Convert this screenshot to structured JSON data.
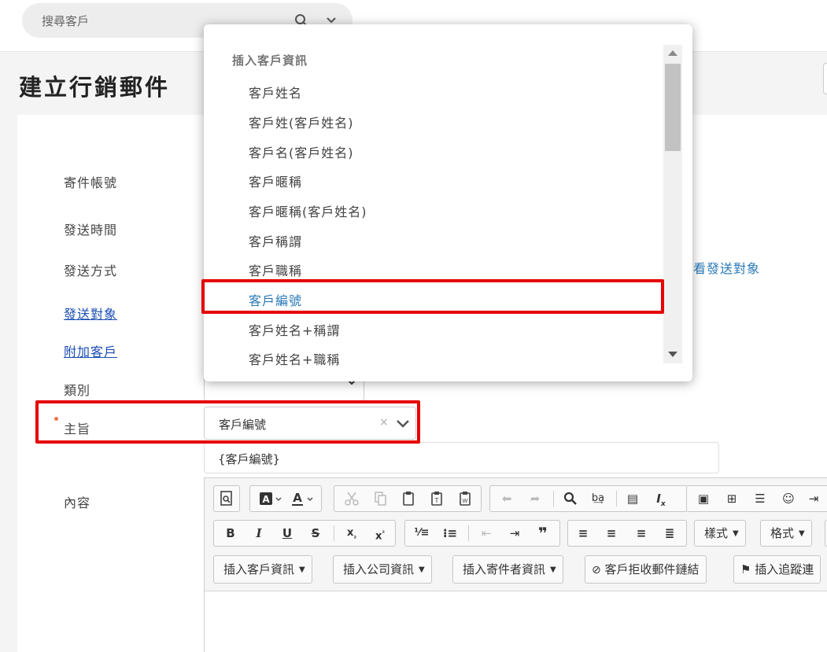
{
  "search": {
    "placeholder": "搜尋客戶"
  },
  "page": {
    "title": "建立行銷郵件"
  },
  "form": {
    "sender_account_label": "寄件帳號",
    "send_time_label": "發送時間",
    "send_method_label": "發送方式",
    "recipients_link": "發送對象",
    "attach_customers_link": "附加客戶",
    "category_label": "類別",
    "subject_label": "主旨",
    "content_label": "內容",
    "view_recipients_link": "看發送對象",
    "subject_value": "客戶編號",
    "subject_clear": "×",
    "subject_preview": "{客戶編號}"
  },
  "dropdown": {
    "heading": "插入客戶資訊",
    "items": [
      "客戶姓名",
      "客戶姓(客戶姓名)",
      "客戶名(客戶姓名)",
      "客戶暱稱",
      "客戶暱稱(客戶姓名)",
      "客戶稱謂",
      "客戶職稱",
      "客戶編號",
      "客戶姓名+稱謂",
      "客戶姓名+職稱"
    ],
    "selected": "客戶編號"
  },
  "editor": {
    "row2": {
      "bold": "B",
      "italic": "I",
      "underline": "U",
      "strike": "S",
      "styles": "樣式",
      "format": "格式"
    },
    "row3": {
      "insert_customer": "插入客戶資訊",
      "insert_company": "插入公司資訊",
      "insert_sender": "插入寄件者資訊",
      "unsubscribe_link": "客戶拒收郵件鏈結",
      "insert_tracking": "插入追蹤連"
    }
  },
  "colors": {
    "highlight": "#e60000",
    "link": "#1a4db3",
    "accent": "#2a7ab8",
    "required": "#e8744c"
  }
}
